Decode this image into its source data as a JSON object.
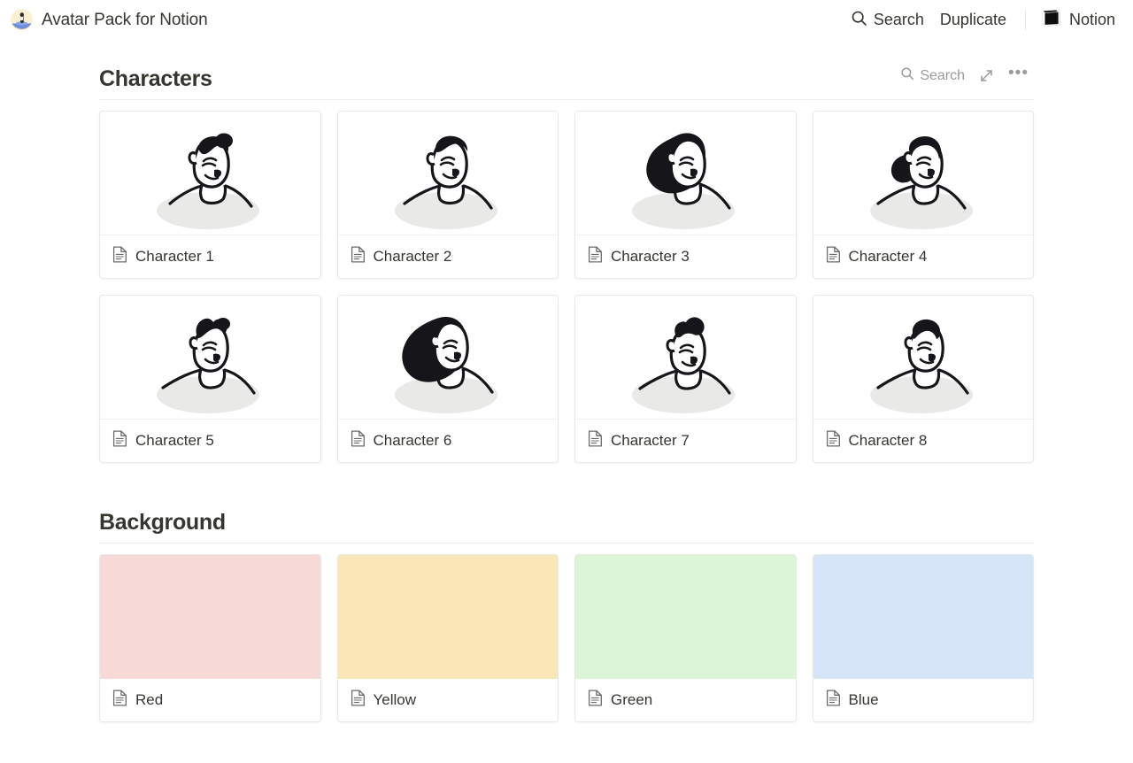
{
  "topbar": {
    "avatar_icon": "avatar-illustration-icon",
    "title": "Avatar Pack for Notion",
    "search_label": "Search",
    "search_icon": "search-icon",
    "duplicate_label": "Duplicate",
    "brand_label": "Notion",
    "brand_icon": "notion-logo-icon"
  },
  "sections": [
    {
      "title": "Characters",
      "tools": {
        "search_label": "Search",
        "search_icon": "search-icon",
        "expand_icon": "expand-diagonal-icon",
        "more_icon": "more-horizontal-icon",
        "more_label": "•••"
      },
      "cards": [
        {
          "label": "Character 1",
          "icon": "page-document-icon",
          "art": "char1"
        },
        {
          "label": "Character 2",
          "icon": "page-document-icon",
          "art": "char2"
        },
        {
          "label": "Character 3",
          "icon": "page-document-icon",
          "art": "char3"
        },
        {
          "label": "Character 4",
          "icon": "page-document-icon",
          "art": "char4"
        },
        {
          "label": "Character 5",
          "icon": "page-document-icon",
          "art": "char5"
        },
        {
          "label": "Character 6",
          "icon": "page-document-icon",
          "art": "char6"
        },
        {
          "label": "Character 7",
          "icon": "page-document-icon",
          "art": "char7"
        },
        {
          "label": "Character 8",
          "icon": "page-document-icon",
          "art": "char8"
        }
      ]
    },
    {
      "title": "Background",
      "cards": [
        {
          "label": "Red",
          "icon": "page-document-icon",
          "color": "#f7dad8"
        },
        {
          "label": "Yellow",
          "icon": "page-document-icon",
          "color": "#fae7b7"
        },
        {
          "label": "Green",
          "icon": "page-document-icon",
          "color": "#ddf5d7"
        },
        {
          "label": "Blue",
          "icon": "page-document-icon",
          "color": "#d6e5f7"
        }
      ]
    }
  ],
  "theme": {
    "background": "#ffffff",
    "text": "#37352f",
    "muted_text": "#9b9a97",
    "border": "#e9e9e7",
    "ink": "#16161a",
    "shadow": "#e8e8e8"
  }
}
